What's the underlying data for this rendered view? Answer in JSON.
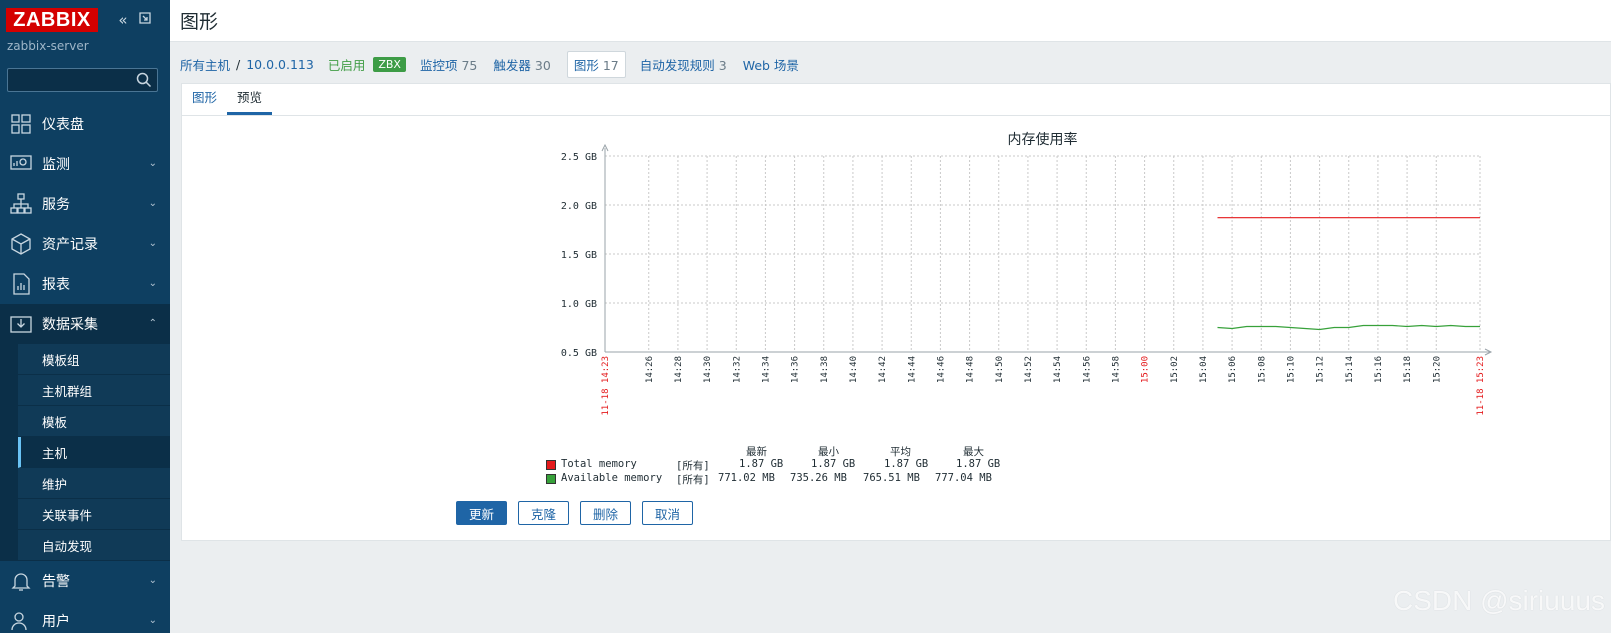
{
  "sidebar": {
    "logo": "ZABBIX",
    "collapse_icon": "double-chevron-left-icon",
    "kiosk_icon": "expand-icon",
    "server_name": "zabbix-server",
    "search_placeholder": "",
    "items": [
      {
        "label": "仪表盘",
        "icon": "dashboard-icon",
        "expandable": false
      },
      {
        "label": "监测",
        "icon": "monitoring-icon",
        "expandable": true
      },
      {
        "label": "服务",
        "icon": "services-icon",
        "expandable": true
      },
      {
        "label": "资产记录",
        "icon": "inventory-icon",
        "expandable": true
      },
      {
        "label": "报表",
        "icon": "reports-icon",
        "expandable": true
      },
      {
        "label": "数据采集",
        "icon": "data-collection-icon",
        "expandable": true,
        "expanded": true
      },
      {
        "label": "告警",
        "icon": "alerts-icon",
        "expandable": true
      },
      {
        "label": "用户",
        "icon": "users-icon",
        "expandable": true
      }
    ],
    "submenu": [
      "模板组",
      "主机群组",
      "模板",
      "主机",
      "维护",
      "关联事件",
      "自动发现"
    ],
    "submenu_current": "主机"
  },
  "header": {
    "title": "图形"
  },
  "breadcrumb": {
    "all_hosts": "所有主机",
    "separator": "/",
    "host": "10.0.0.113",
    "status": "已启用",
    "zbx_badge": "ZBX",
    "items_label": "监控项",
    "items_count": "75",
    "triggers_label": "触发器",
    "triggers_count": "30",
    "graphs_label": "图形",
    "graphs_count": "17",
    "discovery_label": "自动发现规则",
    "discovery_count": "3",
    "web_label": "Web 场景"
  },
  "tabs": [
    "图形",
    "预览"
  ],
  "active_tab": "预览",
  "legend": {
    "headers": [
      "最新",
      "最小",
      "平均",
      "最大"
    ],
    "rows": [
      {
        "name": "Total memory",
        "scope": "[所有]",
        "latest": "1.87 GB",
        "min": "1.87 GB",
        "avg": "1.87 GB",
        "max": "1.87 GB",
        "color": "#e41a1c"
      },
      {
        "name": "Available memory",
        "scope": "[所有]",
        "latest": "771.02 MB",
        "min": "735.26 MB",
        "avg": "765.51 MB",
        "max": "777.04 MB",
        "color": "#37a13a"
      }
    ]
  },
  "buttons": {
    "update": "更新",
    "clone": "克隆",
    "delete": "删除",
    "cancel": "取消"
  },
  "watermark": "CSDN @siriuuus",
  "chart_data": {
    "type": "line",
    "title": "内存使用率",
    "ylabel": "",
    "xlabel": "",
    "y_unit": "GB",
    "y_ticks": [
      "0.5 GB",
      "1.0 GB",
      "1.5 GB",
      "2.0 GB",
      "2.5 GB"
    ],
    "ylim": [
      0.5,
      2.5
    ],
    "x_ticks": [
      "11-18 14:23",
      "14:26",
      "14:28",
      "14:30",
      "14:32",
      "14:34",
      "14:36",
      "14:38",
      "14:40",
      "14:42",
      "14:44",
      "14:46",
      "14:48",
      "14:50",
      "14:52",
      "14:54",
      "14:56",
      "14:58",
      "15:00",
      "15:02",
      "15:04",
      "15:06",
      "15:08",
      "15:10",
      "15:12",
      "15:14",
      "15:16",
      "15:18",
      "15:20",
      "11-18 15:23"
    ],
    "x_ticks_red": [
      "11-18 14:23",
      "15:00",
      "11-18 15:23"
    ],
    "xlim": [
      "14:23",
      "15:23"
    ],
    "grid": true,
    "series": [
      {
        "name": "Total memory",
        "color": "#e41a1c",
        "x": [
          "15:05",
          "15:23"
        ],
        "values": [
          1.87,
          1.87
        ]
      },
      {
        "name": "Available memory",
        "color": "#37a13a",
        "x": [
          "15:05",
          "15:06",
          "15:07",
          "15:08",
          "15:09",
          "15:10",
          "15:11",
          "15:12",
          "15:13",
          "15:14",
          "15:15",
          "15:16",
          "15:17",
          "15:18",
          "15:19",
          "15:20",
          "15:21",
          "15:22",
          "15:23"
        ],
        "values": [
          0.75,
          0.74,
          0.76,
          0.76,
          0.76,
          0.75,
          0.74,
          0.73,
          0.75,
          0.75,
          0.77,
          0.77,
          0.77,
          0.76,
          0.77,
          0.76,
          0.77,
          0.76,
          0.76
        ]
      }
    ]
  }
}
